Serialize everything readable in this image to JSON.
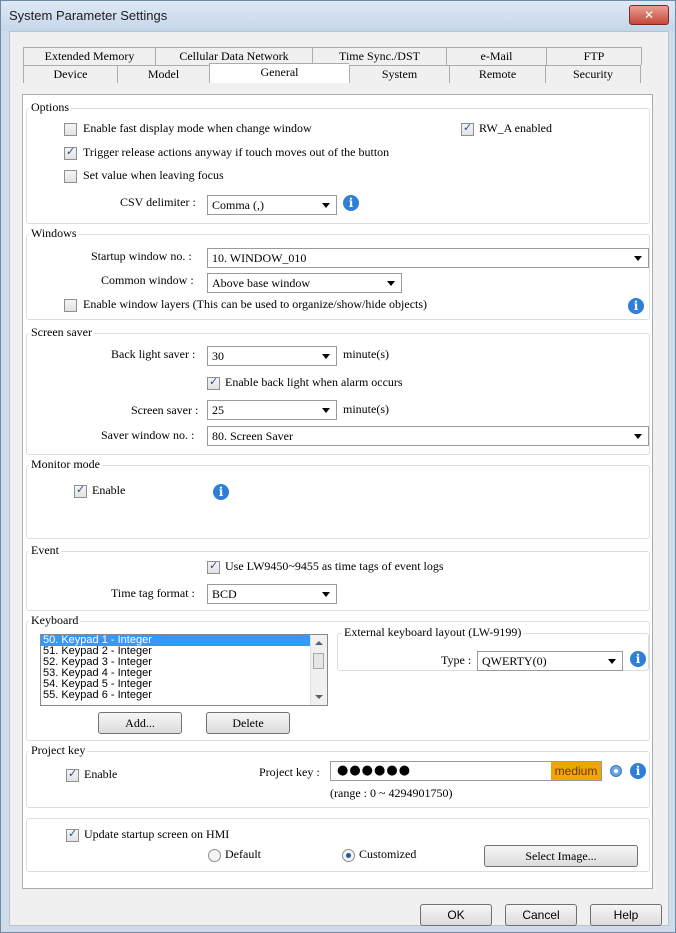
{
  "window": {
    "title": "System Parameter Settings",
    "close_glyph": "✕"
  },
  "tabs": {
    "row1": [
      "Extended Memory",
      "Cellular Data Network",
      "Time Sync./DST",
      "e-Mail",
      "FTP"
    ],
    "row2": [
      "Device",
      "Model",
      "General",
      "System",
      "Remote",
      "Security"
    ],
    "active": "General"
  },
  "options": {
    "label": "Options",
    "fast_display": {
      "label": "Enable fast display mode when change window",
      "checked": false
    },
    "rw_a": {
      "label": "RW_A enabled",
      "checked": true
    },
    "trigger_release": {
      "label": "Trigger release actions anyway if touch moves out of the button",
      "checked": true
    },
    "set_value": {
      "label": "Set value when leaving focus",
      "checked": false
    },
    "csv_label": "CSV delimiter :",
    "csv_value": "Comma (,)"
  },
  "windows": {
    "label": "Windows",
    "startup_label": "Startup window no. :",
    "startup_value": "10. WINDOW_010",
    "common_label": "Common window :",
    "common_value": "Above base window",
    "layers": {
      "label": "Enable window layers (This can be used to organize/show/hide objects)",
      "checked": false
    }
  },
  "screen_saver": {
    "label": "Screen saver",
    "backlight_label": "Back light saver :",
    "backlight_value": "30",
    "backlight_unit": "minute(s)",
    "alarm": {
      "label": "Enable back light when alarm occurs",
      "checked": true
    },
    "saver_label": "Screen saver :",
    "saver_value": "25",
    "saver_unit": "minute(s)",
    "window_label": "Saver window no. :",
    "window_value": "80. Screen Saver"
  },
  "monitor": {
    "label": "Monitor mode",
    "enable": {
      "label": "Enable",
      "checked": true
    }
  },
  "event": {
    "label": "Event",
    "use_lw": {
      "label": "Use LW9450~9455 as time tags of event logs",
      "checked": true
    },
    "format_label": "Time tag format :",
    "format_value": "BCD"
  },
  "keyboard": {
    "label": "Keyboard",
    "items": [
      "50. Keypad 1 - Integer",
      "51. Keypad 2 - Integer",
      "52. Keypad 3 - Integer",
      "53. Keypad 4 - Integer",
      "54. Keypad 5 - Integer",
      "55. Keypad 6 - Integer"
    ],
    "selected_index": 0,
    "add_label": "Add...",
    "delete_label": "Delete",
    "ext_label": "External keyboard layout (LW-9199)",
    "type_label": "Type :",
    "type_value": "QWERTY(0)"
  },
  "project_key": {
    "label": "Project key",
    "enable": {
      "label": "Enable",
      "checked": true
    },
    "key_label": "Project key :",
    "key_mask": "●●●●●●",
    "strength": "medium",
    "range": "(range : 0 ~ 4294901750)"
  },
  "startup_screen": {
    "update": {
      "label": "Update startup screen on HMI",
      "checked": true
    },
    "default_label": "Default",
    "customized_label": "Customized",
    "selected": "Customized",
    "select_image_label": "Select Image..."
  },
  "footer": {
    "ok": "OK",
    "cancel": "Cancel",
    "help": "Help"
  },
  "colors": {
    "accent": "#2f7fd6",
    "strength": "#f2a400",
    "selection": "#3399ff"
  },
  "icons": [
    "info-icon",
    "close-icon",
    "chevron-down-icon",
    "eye-icon"
  ]
}
